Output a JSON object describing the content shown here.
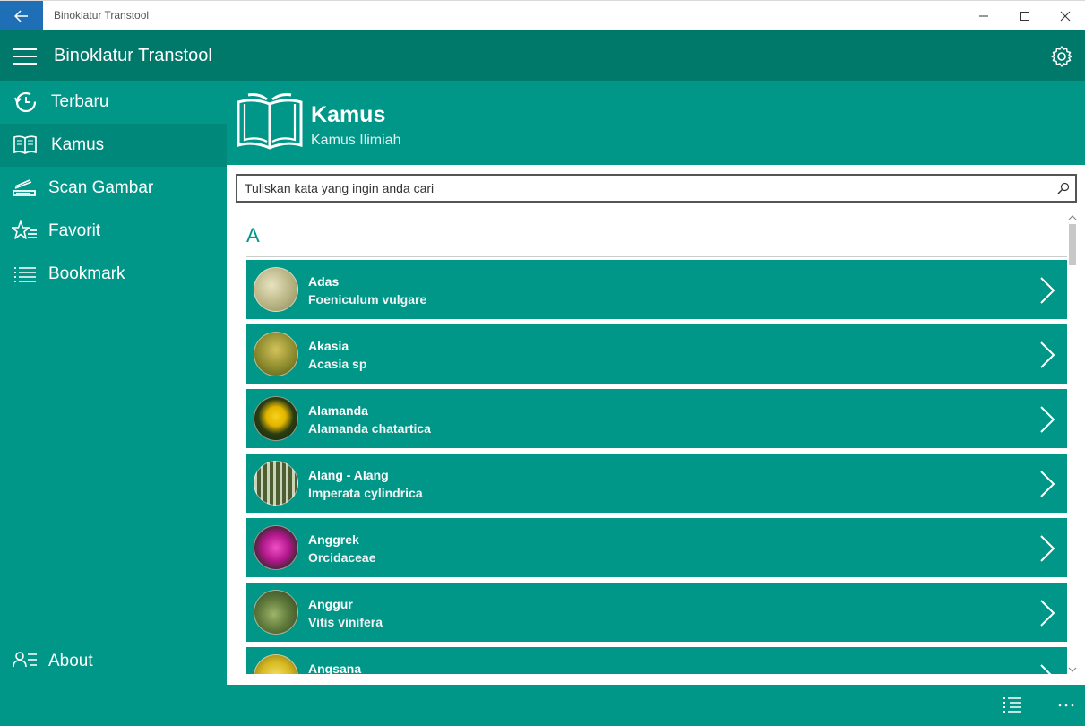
{
  "window": {
    "title": "Binoklatur Transtool"
  },
  "appbar": {
    "title": "Binoklatur Transtool"
  },
  "sidebar": {
    "items": [
      {
        "label": "Terbaru",
        "icon": "history-icon"
      },
      {
        "label": "Kamus",
        "icon": "book-icon",
        "active": true
      },
      {
        "label": "Scan Gambar",
        "icon": "scan-icon"
      },
      {
        "label": "Favorit",
        "icon": "star-list-icon"
      },
      {
        "label": "Bookmark",
        "icon": "bookmark-list-icon"
      }
    ],
    "about": {
      "label": "About",
      "icon": "about-icon"
    }
  },
  "header": {
    "title": "Kamus",
    "subtitle": "Kamus Ilimiah"
  },
  "search": {
    "placeholder": "Tuliskan kata yang ingin anda cari"
  },
  "section": {
    "letter": "A"
  },
  "entries": [
    {
      "name": "Adas",
      "latin": "Foeniculum vulgare"
    },
    {
      "name": "Akasia",
      "latin": "Acasia sp"
    },
    {
      "name": "Alamanda",
      "latin": "Alamanda chatartica"
    },
    {
      "name": "Alang - Alang",
      "latin": "Imperata cylindrica"
    },
    {
      "name": "Anggrek",
      "latin": "Orcidaceae"
    },
    {
      "name": "Anggur",
      "latin": "Vitis vinifera"
    },
    {
      "name": "Angsana",
      "latin": ""
    }
  ],
  "colors": {
    "primary": "#009688",
    "primary_dark": "#00796b",
    "back_button": "#1e6fb5"
  }
}
